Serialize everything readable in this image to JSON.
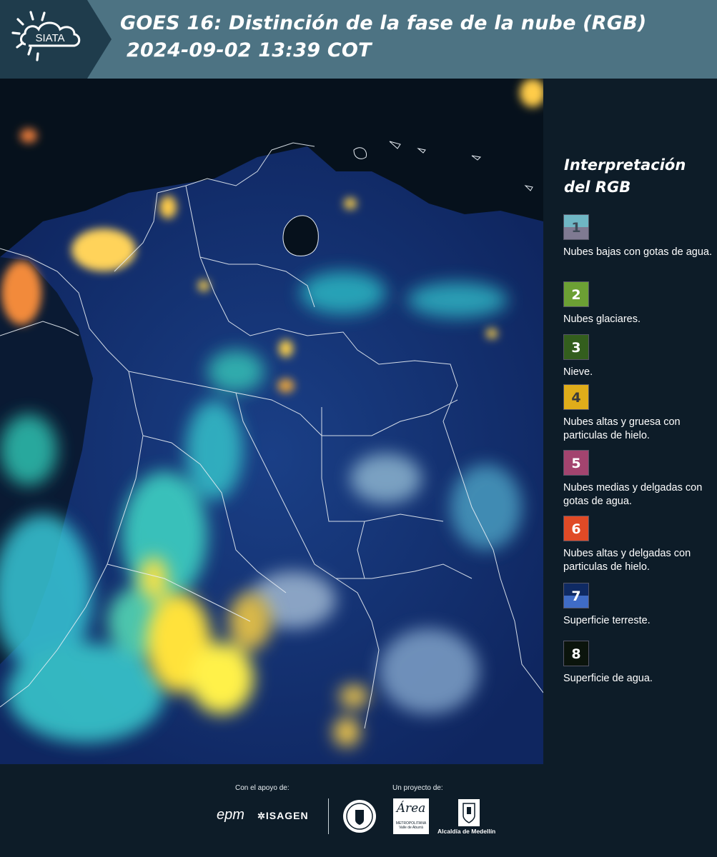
{
  "header": {
    "logo_text": "SIATA",
    "title_line1": "GOES 16: Distinción de la fase de la nube (RGB)",
    "title_line2": "2024-09-02 13:39 COT"
  },
  "legend": {
    "title_line1": "Interpretación",
    "title_line2": "del RGB",
    "items": [
      {
        "number": "1",
        "label": "Nubes bajas con gotas de agua.",
        "color_top": "#6fb6c4",
        "color_bottom": "#7f7a92",
        "text_color": "#3e4a57"
      },
      {
        "number": "2",
        "label": "Nubes glaciares.",
        "color_top": "#6ca034",
        "color_bottom": "#6ca034",
        "text_color": "#ffffff"
      },
      {
        "number": "3",
        "label": "Nieve.",
        "color_top": "#335e1d",
        "color_bottom": "#335e1d",
        "text_color": "#ffffff"
      },
      {
        "number": "4",
        "label": "Nubes altas y gruesa con particulas de hielo.",
        "color_top": "#e0ad1a",
        "color_bottom": "#e0ad1a",
        "text_color": "#3b3b3b"
      },
      {
        "number": "5",
        "label": "Nubes medias y delgadas con gotas de agua.",
        "color_top": "#a3446f",
        "color_bottom": "#a3446f",
        "text_color": "#ffffff"
      },
      {
        "number": "6",
        "label": "Nubes altas y delgadas con particulas de hielo.",
        "color_top": "#e04a26",
        "color_bottom": "#e04a26",
        "text_color": "#ffffff"
      },
      {
        "number": "7",
        "label": "Superficie terreste.",
        "color_top": "#0f2a63",
        "color_bottom": "#3f6cc6",
        "text_color": "#ffffff"
      },
      {
        "number": "8",
        "label": "Superficie de agua.",
        "color_top": "#0b140c",
        "color_bottom": "#0b140c",
        "text_color": "#ffffff"
      }
    ]
  },
  "footer": {
    "support_label": "Con el apoyo de:",
    "project_label": "Un proyecto de:",
    "sponsor1": "epm",
    "sponsor2": "ISAGEN",
    "partner1": "METROPOLITANA Valle de Aburrá",
    "partner1_script": "Área",
    "partner2": "Alcaldía de Medellín"
  }
}
